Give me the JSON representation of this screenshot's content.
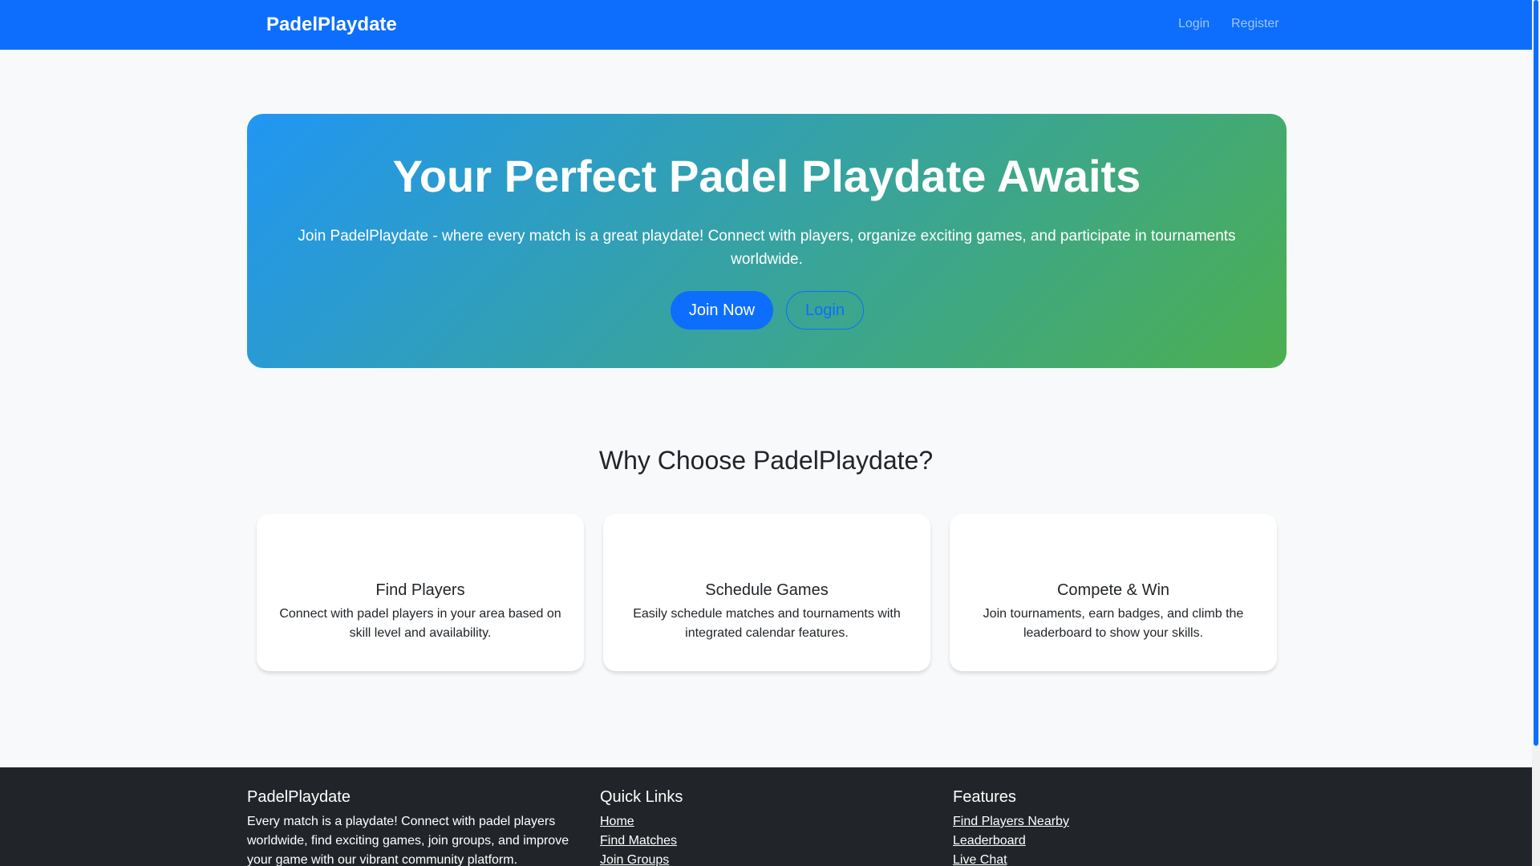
{
  "navbar": {
    "brand": "PadelPlaydate",
    "login_label": "Login",
    "register_label": "Register"
  },
  "hero": {
    "title": "Your Perfect Padel Playdate Awaits",
    "subtitle": "Join PadelPlaydate - where every match is a great playdate! Connect with players, organize exciting games, and participate in tournaments worldwide.",
    "join_label": "Join Now",
    "login_label": "Login"
  },
  "features": {
    "title": "Why Choose PadelPlaydate?",
    "cards": [
      {
        "title": "Find Players",
        "text": "Connect with padel players in your area based on skill level and availability."
      },
      {
        "title": "Schedule Games",
        "text": "Easily schedule matches and tournaments with integrated calendar features."
      },
      {
        "title": "Compete & Win",
        "text": "Join tournaments, earn badges, and climb the leaderboard to show your skills."
      }
    ]
  },
  "footer": {
    "about_title": "PadelPlaydate",
    "about_text": "Every match is a playdate! Connect with padel players worldwide, find exciting games, join groups, and improve your game with our vibrant community platform.",
    "quick_links_title": "Quick Links",
    "quick_links": [
      "Home",
      "Find Matches",
      "Join Groups"
    ],
    "features_title": "Features",
    "features_links": [
      "Find Players Nearby",
      "Leaderboard",
      "Live Chat"
    ]
  },
  "colors": {
    "primary": "#0d6efd",
    "hero_gradient_start": "#2196f3",
    "hero_gradient_end": "#4caf50",
    "footer_bg": "#212529",
    "page_bg": "#f8f9fa"
  }
}
